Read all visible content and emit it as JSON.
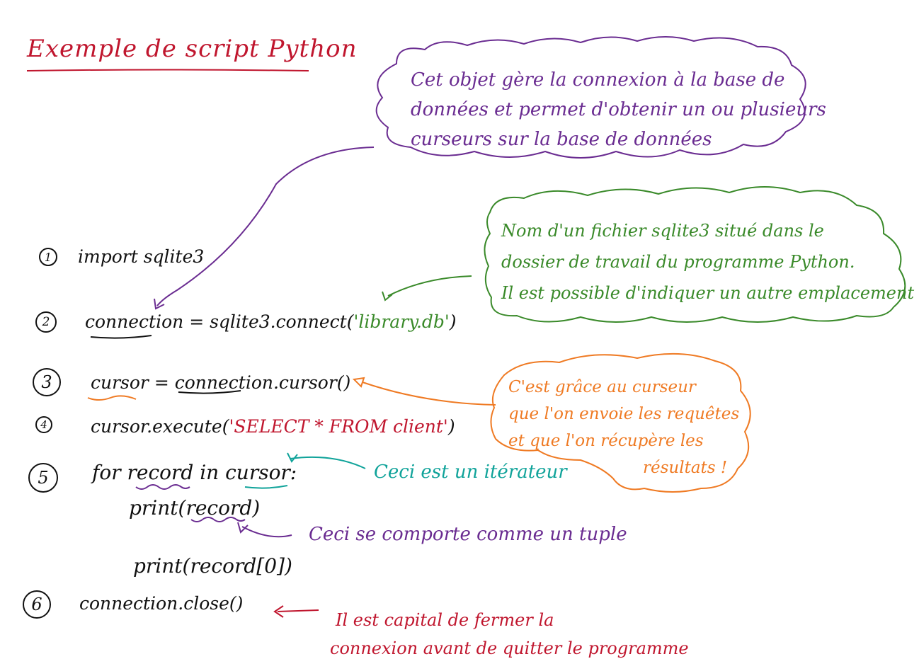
{
  "title": "Exemple de script Python",
  "colors": {
    "title": "#c0162e",
    "code": "#111111",
    "string": "#3a8a2a",
    "sql": "#c0162e",
    "note_connection": "#6a2c91",
    "note_filename": "#3a8a2a",
    "note_cursor": "#ef7a23",
    "note_iterator": "#10a39a",
    "note_tuple": "#6a2c91",
    "note_close": "#c0162e"
  },
  "steps": [
    {
      "number": "1",
      "code": "import sqlite3"
    },
    {
      "number": "2",
      "code_pre": "connection = sqlite3.connect(",
      "code_str": "'library.db'",
      "code_post": ")"
    },
    {
      "number": "3",
      "code": "cursor = connection.cursor()"
    },
    {
      "number": "4",
      "code_pre": "cursor.execute(",
      "code_str": "'SELECT * FROM client'",
      "code_post": ")"
    },
    {
      "number": "5",
      "code": "for record in cursor:",
      "code2": "print(record)",
      "code3": "print(record[0])"
    },
    {
      "number": "6",
      "code": "connection.close()"
    }
  ],
  "notes": {
    "connection": [
      "Cet objet gère la connexion à la base de",
      "données et permet d'obtenir un ou plusieurs",
      "curseurs sur la base de données"
    ],
    "filename": [
      "Nom d'un fichier sqlite3 situé dans le",
      "dossier de travail du programme Python.",
      "Il est possible d'indiquer un autre emplacement"
    ],
    "cursor": [
      "C'est grâce au curseur",
      "que l'on envoie les requêtes",
      "et que l'on récupère les",
      "résultats !"
    ],
    "iterator": "Ceci est un itérateur",
    "tuple": "Ceci se comporte comme un tuple",
    "close": [
      "Il est capital de fermer la",
      "connexion avant de quitter le programme"
    ]
  }
}
